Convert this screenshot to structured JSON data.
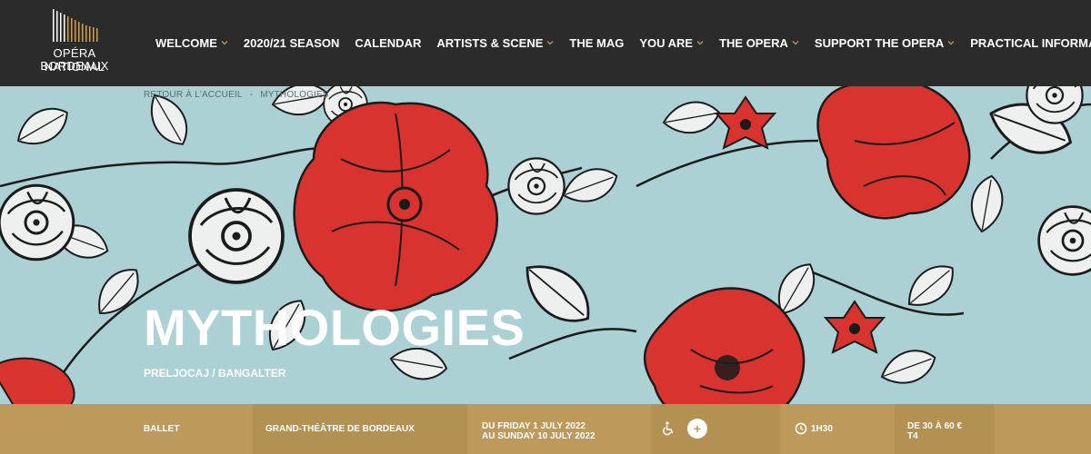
{
  "header": {
    "logo_line1": "OPÉRA NATIONAL",
    "logo_line2": "BORDEAUX",
    "nav": [
      {
        "label": "WELCOME",
        "dropdown": true
      },
      {
        "label": "2020/21 SEASON",
        "dropdown": false
      },
      {
        "label": "CALENDAR",
        "dropdown": false
      },
      {
        "label": "ARTISTS & SCENE",
        "dropdown": true
      },
      {
        "label": "THE MAG",
        "dropdown": false
      },
      {
        "label": "YOU ARE",
        "dropdown": true
      },
      {
        "label": "THE OPERA",
        "dropdown": true
      },
      {
        "label": "SUPPORT THE OPERA",
        "dropdown": true
      },
      {
        "label": "PRACTICAL INFORMATION",
        "dropdown": true
      }
    ]
  },
  "breadcrumb": {
    "home": "RETOUR À L'ACCUEIL",
    "separator": "-",
    "current": "MYTHOLOGIES"
  },
  "hero": {
    "title": "MYTHOLOGIES",
    "subtitle": "PRELJOCAJ / BANGALTER"
  },
  "info": {
    "genre": "BALLET",
    "venue": "GRAND-THÉÂTRE DE BORDEAUX",
    "date_from": "DU FRIDAY 1 JULY 2022",
    "date_to": "AU SUNDAY 10 JULY 2022",
    "plus": "+",
    "duration": "1H30",
    "price": "DE 30 À 60 €",
    "tram": "T4"
  },
  "colors": {
    "header_bg": "#2b2b2b",
    "accent_gold": "#bd9a5b",
    "hero_bg": "#acd1d4",
    "flower_red": "#d93330"
  },
  "icons": [
    "logo-pipes-icon",
    "chevron-down-icon",
    "wheelchair-icon",
    "plus-icon",
    "clock-icon"
  ]
}
